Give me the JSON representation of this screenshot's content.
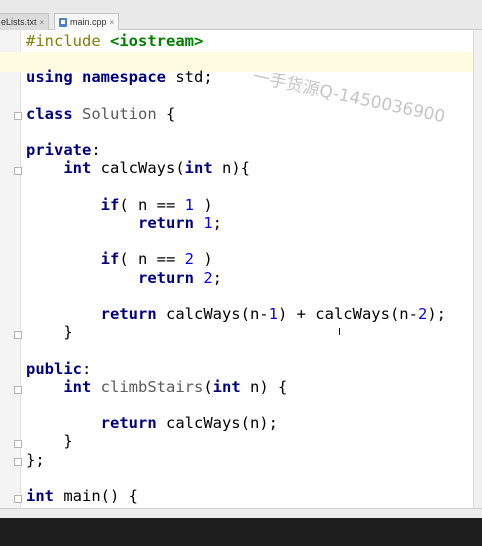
{
  "tabs": [
    {
      "label": "eLists.txt",
      "close": "×",
      "active": false
    },
    {
      "label": "main.cpp",
      "close": "×",
      "active": true
    }
  ],
  "watermark": "一手货源Q-1450036900",
  "code_lines": [
    "#include <iostream>",
    "",
    "using namespace std;",
    "",
    "class Solution {",
    "",
    "private:",
    "    int calcWays(int n){",
    "",
    "        if( n == 1 )",
    "            return 1;",
    "",
    "        if( n == 2 )",
    "            return 2;",
    "",
    "        return calcWays(n-1) + calcWays(n-2);",
    "    }",
    "",
    "public:",
    "    int climbStairs(int n) {",
    "",
    "        return calcWays(n);",
    "    }",
    "};",
    "",
    "int main() {"
  ],
  "colors": {
    "keyword": "#000080",
    "preprocessor": "#808000",
    "header": "#008000",
    "number": "#0000ff",
    "highlight_line": "#fffbe0"
  }
}
